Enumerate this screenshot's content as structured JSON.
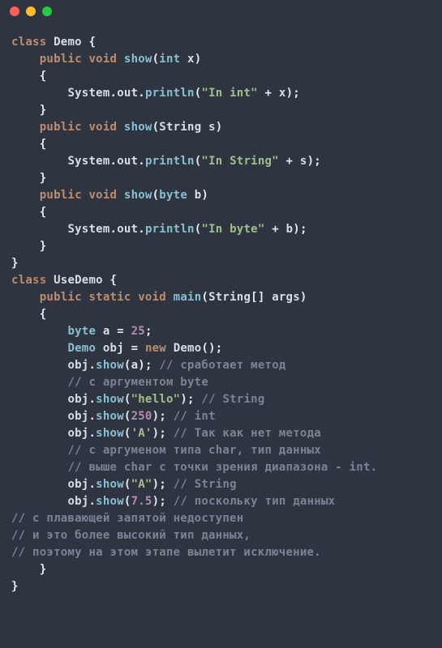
{
  "window": {
    "dot_red": "#ff5f56",
    "dot_yellow": "#ffbd2e",
    "dot_green": "#27c93f"
  },
  "t": {
    "kw_class1": "class",
    "cls_Demo1": "Demo",
    "brace_o1": "{",
    "kw_public1": "public",
    "kw_void1": "void",
    "fn_show1": "show",
    "lp1": "(",
    "type_int1": "int",
    "id_x1": "x",
    "rp1": ")",
    "brace_o2": "{",
    "id_System1": "System",
    "dot1": ".",
    "id_out1": "out",
    "dot2": ".",
    "fn_println1": "println",
    "lp2": "(",
    "str_inint": "\"In int\"",
    "plus1": "+",
    "id_x2": "x",
    "rp2": ")",
    "semi1": ";",
    "brace_c1": "}",
    "kw_public2": "public",
    "kw_void2": "void",
    "fn_show2": "show",
    "lp3": "(",
    "type_String1": "String",
    "id_s1": "s",
    "rp3": ")",
    "brace_o3": "{",
    "id_System2": "System",
    "dot3": ".",
    "id_out2": "out",
    "dot4": ".",
    "fn_println2": "println",
    "lp4": "(",
    "str_instring": "\"In String\"",
    "plus2": "+",
    "id_s2": "s",
    "rp4": ")",
    "semi2": ";",
    "brace_c2": "}",
    "kw_public3": "public",
    "kw_void3": "void",
    "fn_show3": "show",
    "lp5": "(",
    "type_byte1": "byte",
    "id_b1": "b",
    "rp5": ")",
    "brace_o4": "{",
    "id_System3": "System",
    "dot5": ".",
    "id_out3": "out",
    "dot6": ".",
    "fn_println3": "println",
    "lp6": "(",
    "str_inbyte": "\"In byte\"",
    "plus3": "+",
    "id_b2": "b",
    "rp6": ")",
    "semi3": ";",
    "brace_c3": "}",
    "brace_c4": "}",
    "kw_class2": "class",
    "cls_UseDemo": "UseDemo",
    "brace_o5": "{",
    "kw_public4": "public",
    "kw_static1": "static",
    "kw_void4": "void",
    "fn_main": "main",
    "lp7": "(",
    "type_String2": "String",
    "arr1": "[]",
    "id_args": "args",
    "rp7": ")",
    "brace_o6": "{",
    "type_byte2": "byte",
    "id_a1": "a",
    "eq1": "=",
    "num_25": "25",
    "semi4": ";",
    "type_Demo2": "Demo",
    "id_obj1": "obj",
    "eq2": "=",
    "kw_new1": "new",
    "cls_Demo3": "Demo",
    "lp8": "(",
    "rp8": ")",
    "semi5": ";",
    "id_obj2": "obj",
    "dot7": ".",
    "fn_show4": "show",
    "lp9": "(",
    "id_a2": "a",
    "rp9": ")",
    "semi6": ";",
    "cmt1": "// сработает метод",
    "cmt2": "// с аргументом byte",
    "id_obj3": "obj",
    "dot8": ".",
    "fn_show5": "show",
    "lp10": "(",
    "str_hello": "\"hello\"",
    "rp10": ")",
    "semi7": ";",
    "cmt3": "// String",
    "id_obj4": "obj",
    "dot9": ".",
    "fn_show6": "show",
    "lp11": "(",
    "num_250": "250",
    "rp11": ")",
    "semi8": ";",
    "cmt4": "// int",
    "id_obj5": "obj",
    "dot10": ".",
    "fn_show7": "show",
    "lp12": "(",
    "chr_A": "'A'",
    "rp12": ")",
    "semi9": ";",
    "cmt5": "// Так как нет метода",
    "cmt6": "// с аргуменом типа char, тип данных",
    "cmt7": "// выше char с точки зрения диапазона - int.",
    "id_obj6": "obj",
    "dot11": ".",
    "fn_show8": "show",
    "lp13": "(",
    "str_A": "\"A\"",
    "rp13": ")",
    "semi10": ";",
    "cmt8": "// String",
    "id_obj7": "obj",
    "dot12": ".",
    "fn_show9": "show",
    "lp14": "(",
    "num_7_5": "7.5",
    "rp14": ")",
    "semi11": ";",
    "cmt9": "// поскольку тип данных",
    "cmt10": "// с плавающей запятой недоступен",
    "cmt11": "// и это более высокий тип данных,",
    "cmt12": "// поэтому на этом этапе вылетит исключение.",
    "brace_c5": "}",
    "brace_c6": "}"
  }
}
